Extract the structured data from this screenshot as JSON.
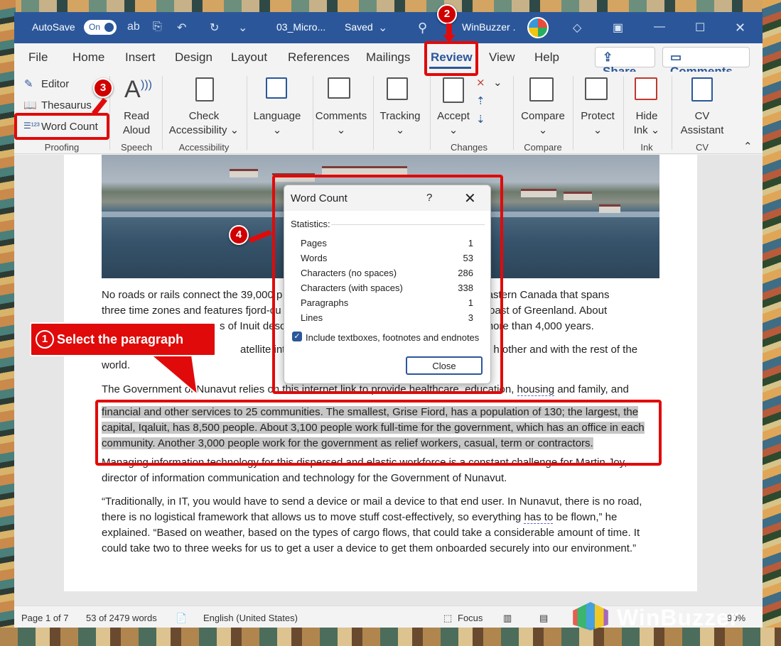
{
  "titlebar": {
    "autosave_label": "AutoSave",
    "autosave_state": "On",
    "doc_name": "03_Micro...",
    "save_status": "Saved",
    "user_name": "WinBuzzer ."
  },
  "menu": {
    "tabs": [
      "File",
      "Home",
      "Insert",
      "Design",
      "Layout",
      "References",
      "Mailings",
      "Review",
      "View",
      "Help"
    ],
    "share": "Share",
    "comments": "Comments"
  },
  "ribbon": {
    "editor": "Editor",
    "thesaurus": "Thesaurus",
    "word_count": "Word Count",
    "read_aloud": [
      "Read",
      "Aloud"
    ],
    "check_accessibility": [
      "Check",
      "Accessibility ⌄"
    ],
    "language": "Language",
    "comments": "Comments",
    "tracking": "Tracking",
    "accept": "Accept",
    "compare": "Compare",
    "protect": "Protect",
    "hide_ink": [
      "Hide",
      "Ink ⌄"
    ],
    "cv_assistant": [
      "CV",
      "Assistant"
    ],
    "groups": [
      "Proofing",
      "Speech",
      "Accessibility",
      "Changes",
      "Compare",
      "Ink",
      "CV"
    ]
  },
  "document": {
    "p1_l1a": "No roads or rails connect the 39,000 p",
    "p1_l1b": "in northeastern Canada that spans",
    "p1_l2a": "three time zones and features fjord-cu",
    "p1_l2b": "the west coast of Greenland. About",
    "p1_l3a": "s of Inuit desce",
    "p1_l3b": "c more than 4,000 years.",
    "p2_l1a": "atellite interne",
    "p2_l1b": "h other and with the rest of the",
    "p2_l2": "world.",
    "p3_l1a": "The Government of Nunavut relies on this internet link to provide healthcare, education,",
    "p3_l1b": "housing",
    "p3_l1c": "and family, and",
    "sel_l1": "financial and other services to 25 communities. The smallest, Grise Fiord, has a population of 130; the largest, the",
    "sel_l2": "capital, Iqaluit, has 8,500 people. About 3,100 people work full-time for the government, which has an office in each",
    "sel_l3": "community. Another 3,000 people work for the government as relief workers, casual, term or contractors.",
    "p4_l1": "Managing information technology for this dispersed and elastic workforce is a constant challenge for Martin Joy,",
    "p4_l2": "director of information communication and technology for the Government of Nunavut.",
    "p5_l1": "“Traditionally, in IT, you would have to send a device or mail a device to that end user. In Nunavut, there is no road,",
    "p5_l2a": "there is no logistical framework that allows us to move stuff cost-effectively, so everything",
    "p5_l2b": "has to",
    "p5_l2c": "be flown,” he",
    "p5_l3": "explained. “Based on weather, based on the types of cargo flows, that could take a considerable amount of time. It",
    "p5_l4": "could take two to three weeks for us to get a user a device to get them onboarded securely into our environment.”"
  },
  "dialog": {
    "title": "Word Count",
    "help": "?",
    "statistics": "Statistics:",
    "rows": [
      {
        "label": "Pages",
        "value": "1"
      },
      {
        "label": "Words",
        "value": "53"
      },
      {
        "label": "Characters (no spaces)",
        "value": "286"
      },
      {
        "label": "Characters (with spaces)",
        "value": "338"
      },
      {
        "label": "Paragraphs",
        "value": "1"
      },
      {
        "label": "Lines",
        "value": "3"
      }
    ],
    "include_label": "Include textboxes, footnotes and endnotes",
    "include_checked": true,
    "close": "Close"
  },
  "statusbar": {
    "page": "Page 1 of 7",
    "words": "53 of 2479 words",
    "language": "English (United States)",
    "focus": "Focus",
    "zoom": "90%"
  },
  "annotations": {
    "step1": "1",
    "step1_text": "Select the paragraph",
    "step2": "2",
    "step3": "3",
    "step4": "4"
  },
  "watermark": "WinBuzzer",
  "colors": {
    "accent": "#2b579a",
    "highlight_red": "#e10a0a",
    "selection": "#c7c7c7"
  }
}
